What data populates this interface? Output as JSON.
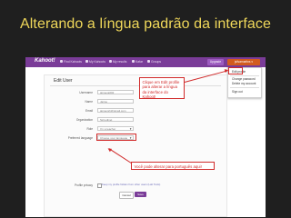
{
  "slide": {
    "title": "Alterando a língua padrão da interface"
  },
  "navbar": {
    "brand": "Kahoot!",
    "items": [
      "Find Kahoots",
      "My Kahoots",
      "My results",
      "Kafar",
      "Groups"
    ],
    "upgrade_label": "Upgrade",
    "user_label": "jsilvamartins",
    "accent_color": "#7a3c98"
  },
  "dropdown": {
    "items": [
      "Edit profile",
      "Change password",
      "Delete my account",
      "Sign out"
    ]
  },
  "edit_user": {
    "title": "Edit User",
    "fields": [
      {
        "label": "Username",
        "value": "jaimeva002"
      },
      {
        "label": "Name",
        "value": "Jaime"
      },
      {
        "label": "Email",
        "value": "jaimevsh@gmail.com"
      },
      {
        "label": "Organization",
        "value": "Sicredinet"
      },
      {
        "label": "Role",
        "value": "I'm a teacher"
      },
      {
        "label": "Preferred language",
        "value": "Choose your language"
      }
    ],
    "profile_privacy_label": "Profile privacy",
    "privacy_text": "Keep my profile hidden from other users (Lab Tools)",
    "cancel_label": "Cancel",
    "save_label": "Save"
  },
  "annotations": {
    "edit_profile_callout": "Clique em Edit profile para alterar a língua da interface do Kahoot!",
    "language_callout": "Você pode alterar para português aqui!",
    "highlight_color": "#d12b2b"
  }
}
